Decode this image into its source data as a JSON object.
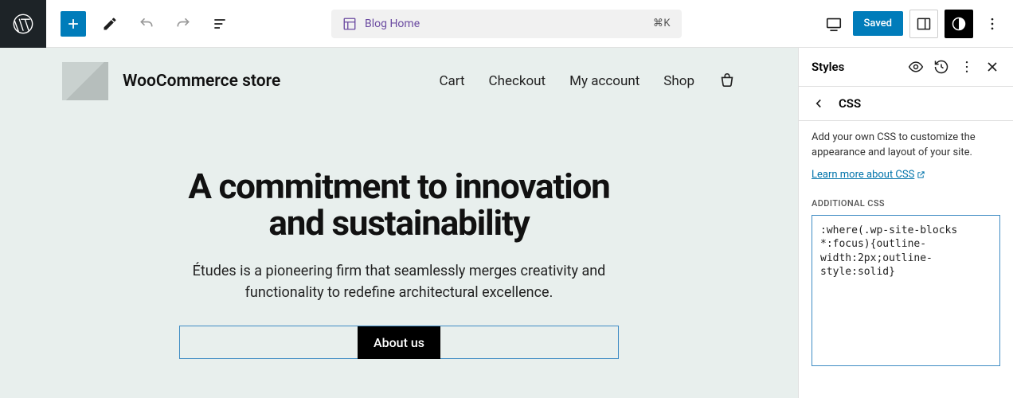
{
  "topbar": {
    "doc_title": "Blog Home",
    "shortcut": "⌘K",
    "saved_label": "Saved"
  },
  "site": {
    "title": "WooCommerce store",
    "nav": [
      "Cart",
      "Checkout",
      "My account",
      "Shop"
    ]
  },
  "hero": {
    "heading_line1": "A commitment to innovation",
    "heading_line2": "and sustainability",
    "body": "Études is a pioneering firm that seamlessly merges creativity and functionality to redefine architectural excellence.",
    "button": "About us"
  },
  "sidebar": {
    "title": "Styles",
    "crumb": "CSS",
    "description": "Add your own CSS to customize the appearance and layout of your site.",
    "learn_link": "Learn more about CSS",
    "field_label": "Additional CSS",
    "css_value": ":where(.wp-site-blocks *:focus){outline-width:2px;outline-style:solid}"
  }
}
